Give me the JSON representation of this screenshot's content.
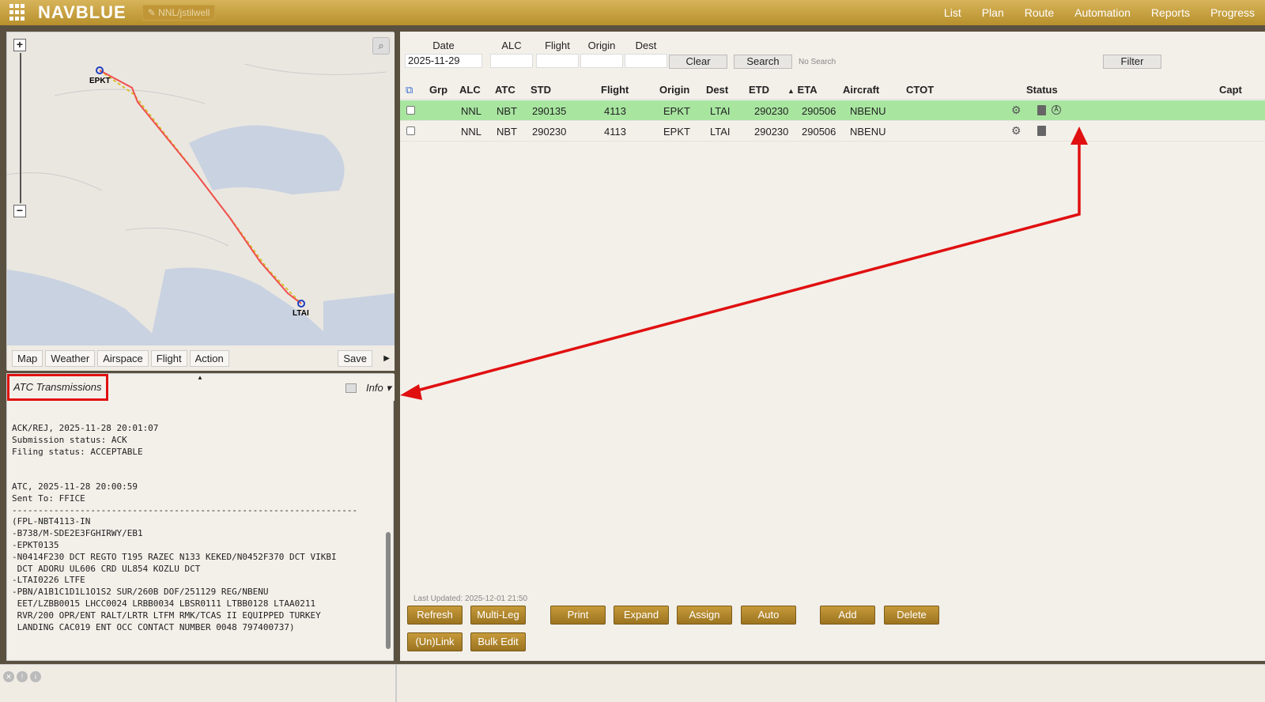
{
  "app": {
    "brand": "NAVBLUE",
    "user": "NNL/jstilwell"
  },
  "nav": [
    "List",
    "Plan",
    "Route",
    "Automation",
    "Reports",
    "Progress"
  ],
  "map": {
    "airports": {
      "origin": "EPKT",
      "dest": "LTAI"
    },
    "tabs": [
      "Map",
      "Weather",
      "Airspace",
      "Flight",
      "Action"
    ],
    "save_label": "Save"
  },
  "atc": {
    "title": "ATC Transmissions",
    "info_label": "Info",
    "log": "ACK/REJ, 2025-11-28 20:01:07\nSubmission status: ACK\nFiling status: ACCEPTABLE\n\n\nATC, 2025-11-28 20:00:59\nSent To: FFICE\n------------------------------------------------------------------\n(FPL-NBT4113-IN\n-B738/M-SDE2E3FGHIRWY/EB1\n-EPKT0135\n-N0414F230 DCT REGTO T195 RAZEC N133 KEKED/N0452F370 DCT VIKBI\n DCT ADORU UL606 CRD UL854 KOZLU DCT\n-LTAI0226 LTFE\n-PBN/A1B1C1D1L1O1S2 SUR/260B DOF/251129 REG/NBENU\n EET/LZBB0015 LHCC0024 LRBB0034 LBSR0111 LTBB0128 LTAA0211\n RVR/200 OPR/ENT RALT/LRTR LTFM RMK/TCAS II EQUIPPED TURKEY\n LANDING CAC019 ENT OCC CONTACT NUMBER 0048 797400737)"
  },
  "search": {
    "date_label": "Date",
    "date_value": "2025-11-29",
    "alc_label": "ALC",
    "flight_label": "Flight",
    "origin_label": "Origin",
    "dest_label": "Dest",
    "clear_label": "Clear",
    "search_label": "Search",
    "status_text": "No Search",
    "filter_label": "Filter"
  },
  "columns": [
    "Grp",
    "ALC",
    "ATC",
    "STD",
    "Flight",
    "Origin",
    "Dest",
    "ETD",
    "ETA",
    "Aircraft",
    "CTOT",
    "Status",
    "Capt"
  ],
  "rows": [
    {
      "grp": "",
      "alc": "NNL",
      "atc": "NBT",
      "std": "290135",
      "flight": "4113",
      "origin": "EPKT",
      "dest": "LTAI",
      "etd": "290230",
      "eta": "290506",
      "aircraft": "NBENU",
      "ctot": ""
    },
    {
      "grp": "",
      "alc": "NNL",
      "atc": "NBT",
      "std": "290230",
      "flight": "4113",
      "origin": "EPKT",
      "dest": "LTAI",
      "etd": "290230",
      "eta": "290506",
      "aircraft": "NBENU",
      "ctot": ""
    }
  ],
  "last_updated": "Last Updated: 2025-12-01 21:50",
  "actions": {
    "refresh": "Refresh",
    "multi_leg": "Multi-Leg",
    "print": "Print",
    "expand": "Expand",
    "assign": "Assign",
    "auto": "Auto",
    "add": "Add",
    "delete": "Delete",
    "unlink": "(Un)Link",
    "bulk_edit": "Bulk Edit"
  },
  "colors": {
    "brand_gold": "#c9a040",
    "active_row": "#a8e6a0",
    "annotation_red": "#e01010",
    "route_red": "#f05050",
    "route_yellow": "#d0c020"
  }
}
